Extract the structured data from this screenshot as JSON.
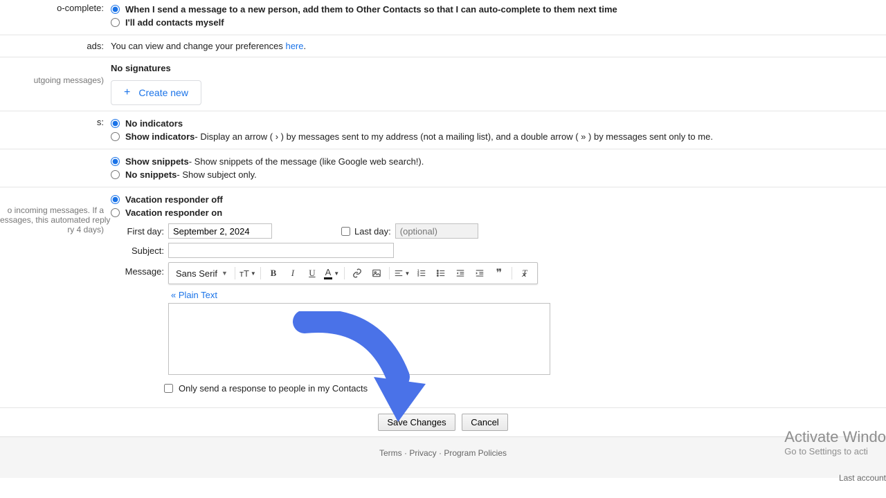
{
  "autoComplete": {
    "label": "o-complete:",
    "opt1": "When I send a message to a new person, add them to Other Contacts so that I can auto-complete to them next time",
    "opt2": "I'll add contacts myself"
  },
  "ads": {
    "label": "ads:",
    "text": "You can view and change your preferences ",
    "link": "here",
    "after": "."
  },
  "signature": {
    "sub": "utgoing messages)",
    "noSig": "No signatures",
    "createNew": "Create new"
  },
  "indicators": {
    "label": "s:",
    "opt1": "No indicators",
    "opt2": "Show indicators",
    "opt2desc": " - Display an arrow ( › ) by messages sent to my address (not a mailing list), and a double arrow ( » ) by messages sent only to me."
  },
  "snippets": {
    "opt1": "Show snippets",
    "opt1desc": " - Show snippets of the message (like Google web search!).",
    "opt2": "No snippets",
    "opt2desc": " - Show subject only."
  },
  "vacation": {
    "sub1": "o incoming messages. If a",
    "sub2": "essages, this automated reply",
    "sub3": "ry 4 days)",
    "off": "Vacation responder off",
    "on": "Vacation responder on",
    "firstDayLabel": "First day:",
    "firstDayValue": "September 2, 2024",
    "lastDayLabel": "Last day:",
    "lastDayPlaceholder": "(optional)",
    "subjectLabel": "Subject:",
    "subjectValue": "",
    "messageLabel": "Message:",
    "fontName": "Sans Serif",
    "plainText": "« Plain Text",
    "onlyContacts": "Only send a response to people in my Contacts"
  },
  "actions": {
    "save": "Save Changes",
    "cancel": "Cancel"
  },
  "footer": {
    "terms": "Terms",
    "privacy": "Privacy",
    "policies": "Program Policies",
    "lastAccount": "Last account"
  },
  "overlay": {
    "line1": "Activate Windo",
    "line2": "Go to Settings to acti"
  }
}
